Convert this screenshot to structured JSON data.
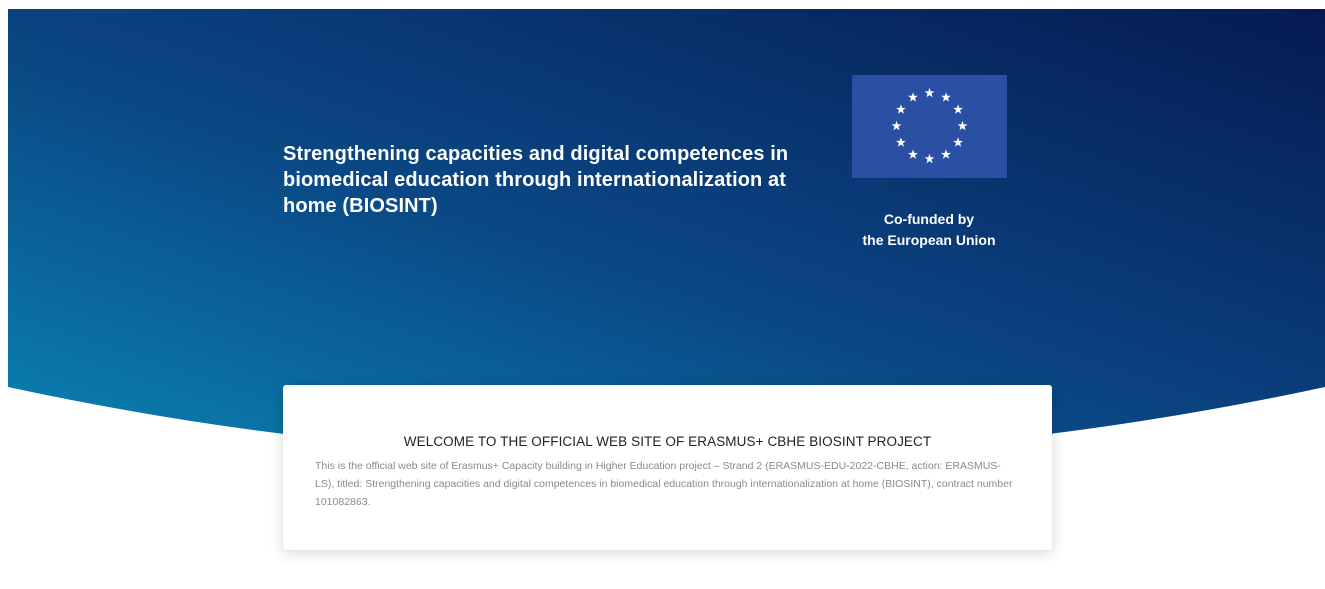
{
  "hero": {
    "title": "Strengthening capacities and digital competences in biomedical education through internationalization at home (BIOSINT)",
    "gradient_start": "#0a7fb0",
    "gradient_mid": "#0a4a86",
    "gradient_end": "#071f57",
    "funding": {
      "flag_icon": "eu-flag-icon",
      "flag_color": "#2a4fa3",
      "star_color": "#ffffff",
      "line1": "Co-funded by",
      "line2": "the European Union"
    }
  },
  "welcome": {
    "heading": "WELCOME TO THE OFFICIAL WEB SITE OF ERASMUS+ CBHE BIOSINT PROJECT",
    "body": "This is the official web site of Erasmus+ Capacity building in Higher Education project – Strand 2 (ERASMUS-EDU-2022-CBHE, action: ERASMUS-LS), titled: Strengthening capacities and digital competences in biomedical education through internationalization at home (BIOSINT), contract number 101082863."
  }
}
